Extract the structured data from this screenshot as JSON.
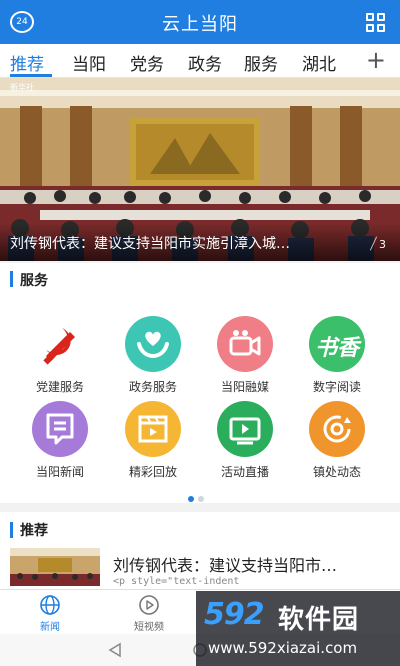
{
  "header": {
    "title": "云上当阳",
    "clock_badge": "24",
    "background": "#1f7ee0"
  },
  "tabs": {
    "items": [
      "推荐",
      "当阳",
      "党务",
      "政务",
      "服务",
      "湖北"
    ],
    "active_index": 0,
    "more_label": "+"
  },
  "banner": {
    "caption": "刘传钢代表：建议支持当阳市实施引漳入城…",
    "page_indicator": "3",
    "corner_mark": "新华社"
  },
  "services": {
    "title": "服务",
    "items": [
      {
        "label": "党建服务",
        "icon": "party-emblem-icon",
        "color": "#ffffff"
      },
      {
        "label": "政务服务",
        "icon": "heart-hands-icon",
        "color": "#3ec6b4"
      },
      {
        "label": "当阳融媒",
        "icon": "camera-icon",
        "color": "#f07e86"
      },
      {
        "label": "数字阅读",
        "icon": "calligraphy-icon",
        "color": "#3cbf6a"
      },
      {
        "label": "当阳新闻",
        "icon": "news-chat-icon",
        "color": "#a57ad8"
      },
      {
        "label": "精彩回放",
        "icon": "clapperboard-icon",
        "color": "#f5b634"
      },
      {
        "label": "活动直播",
        "icon": "tv-play-icon",
        "color": "#2aae5c"
      },
      {
        "label": "镇处动态",
        "icon": "refresh-circle-icon",
        "color": "#f0952c"
      }
    ],
    "calligraphy_text": "书香"
  },
  "recommend": {
    "title": "推荐",
    "news": [
      {
        "title": "刘传钢代表：建议支持当阳市…",
        "snippet": "<p style=\"text-indent"
      }
    ]
  },
  "bottom_nav": {
    "items": [
      {
        "label": "新闻",
        "icon": "globe-icon"
      },
      {
        "label": "短视频",
        "icon": "play-circle-icon"
      }
    ],
    "active_index": 0
  },
  "watermark": {
    "logo": "592",
    "name": "软件园",
    "url": "www.592xiazai.com"
  }
}
